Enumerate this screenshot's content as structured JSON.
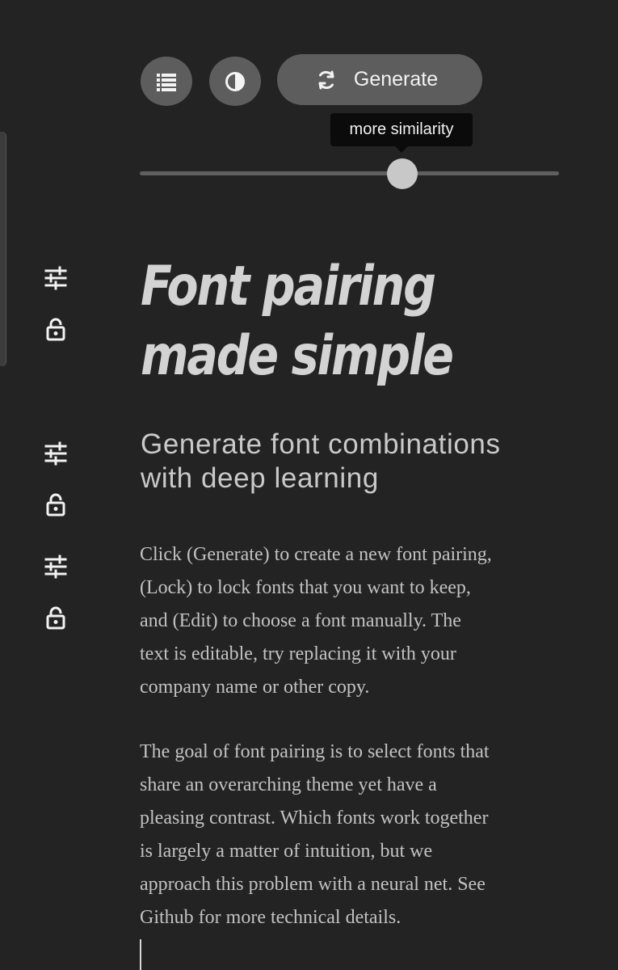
{
  "toolbar": {
    "list_button_icon": "list-icon",
    "contrast_button_icon": "contrast-icon",
    "generate_button_icon": "refresh-icon",
    "generate_label": "Generate"
  },
  "similarity_slider": {
    "tooltip": "more similarity",
    "value_fraction": 0.627
  },
  "font_rows": [
    {
      "edit_icon": "sliders-icon",
      "lock_icon": "unlocked-padlock-icon"
    },
    {
      "edit_icon": "sliders-icon",
      "lock_icon": "unlocked-padlock-icon"
    },
    {
      "edit_icon": "sliders-icon",
      "lock_icon": "unlocked-padlock-icon"
    }
  ],
  "content": {
    "headline_line_1": "Font pairing",
    "headline_line_2": "made simple",
    "subheading_line_1": "Generate font combinations",
    "subheading_line_2": "with deep learning",
    "paragraph_1": [
      "Click (Generate) to create a new font pairing,",
      "(Lock) to lock fonts that you want to keep,",
      "and (Edit) to choose a font manually. The",
      "text is editable, try replacing it with your",
      "company name or other copy."
    ],
    "paragraph_2": [
      "The goal of font pairing is to select fonts that",
      "share an overarching theme yet have a",
      "pleasing contrast. Which fonts work together",
      "is largely a matter of intuition, but we",
      "approach this problem with a neural net. See",
      "Github for more technical details."
    ]
  },
  "colors": {
    "background": "#232323",
    "button": "#5d5d5d",
    "headline": "#d3d3d3",
    "body_text": "#c2c2c2",
    "tooltip": "#0b0b0b"
  }
}
